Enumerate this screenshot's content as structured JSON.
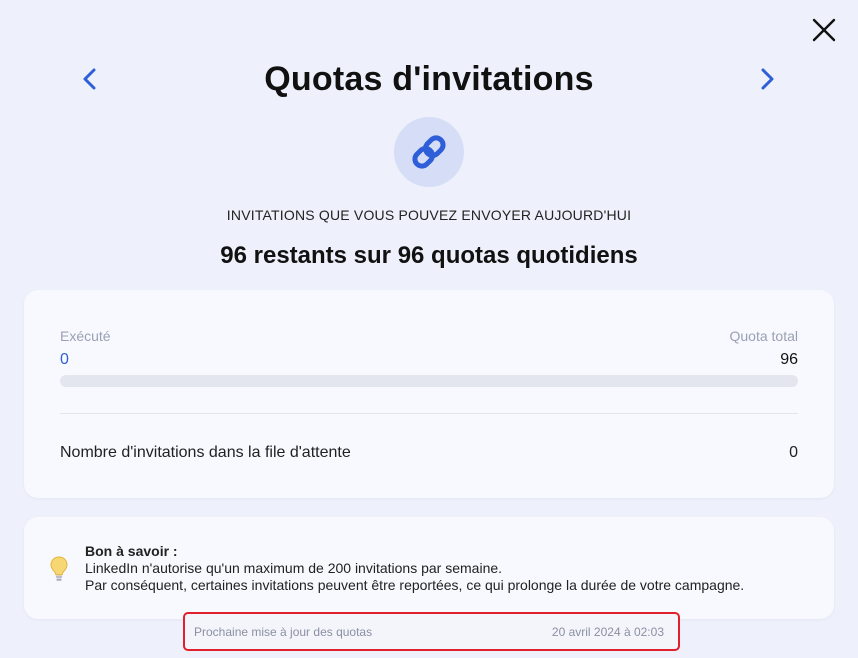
{
  "modal": {
    "title": "Quotas d'invitations",
    "subtitle": "INVITATIONS QUE VOUS POUVEZ ENVOYER AUJOURD'HUI",
    "headline": "96 restants sur 96 quotas quotidiens"
  },
  "quota": {
    "executed_label": "Exécuté",
    "executed_value": "0",
    "total_label": "Quota total",
    "total_value": "96",
    "progress_fraction": 0,
    "queue_label": "Nombre d'invitations dans la file d'attente",
    "queue_value": "0"
  },
  "info": {
    "title": "Bon à savoir :",
    "line1": "LinkedIn n'autorise qu'un maximum de 200 invitations par semaine.",
    "line2": "Par conséquent, certaines invitations peuvent être reportées, ce qui prolonge la durée de votre campagne."
  },
  "next_update": {
    "label": "Prochaine mise à jour des quotas",
    "value": "20 avril 2024 à 02:03"
  },
  "icons": {
    "close": "close-icon",
    "prev": "chevron-left-icon",
    "next": "chevron-right-icon",
    "link": "link-icon",
    "bulb": "lightbulb-icon"
  },
  "colors": {
    "accent": "#2f5fd8",
    "background": "#eef1fb",
    "highlight_border": "#e0202c"
  }
}
